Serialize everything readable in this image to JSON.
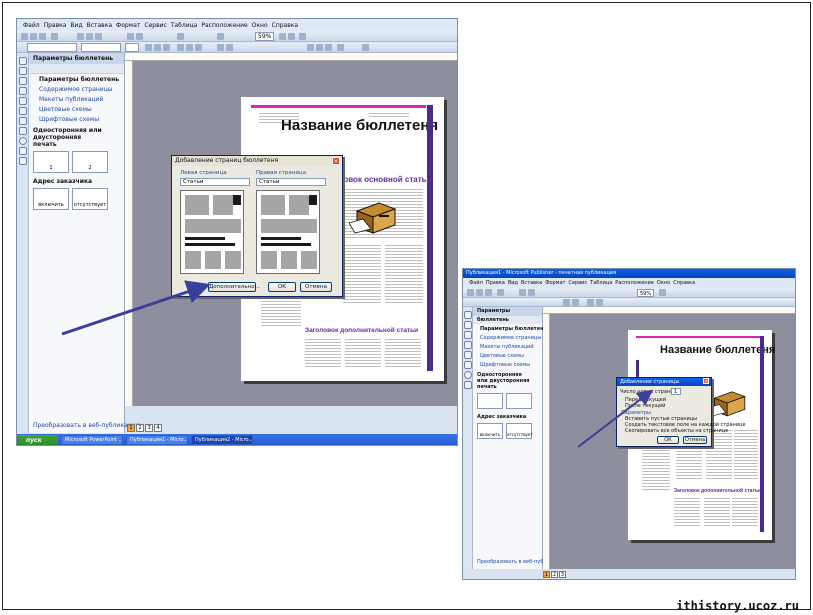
{
  "screenshot_left": {
    "menu": [
      "Файл",
      "Правка",
      "Вид",
      "Вставка",
      "Формат",
      "Сервис",
      "Таблица",
      "Расположение",
      "Окно",
      "Справка"
    ],
    "zoom": "59%",
    "taskpane": {
      "title": "Параметры бюллетень",
      "items": [
        "Параметры бюллетень",
        "Содержимое страницы",
        "Макеты публикаций",
        "Цветовые схемы",
        "Шрифтовые схемы"
      ],
      "print_heading": "Односторонняя или двусторонняя печать",
      "print_options": [
        "1",
        "2"
      ],
      "address_heading": "Адрес заказчика",
      "address_options": [
        "включить",
        "отсутствует"
      ],
      "convert_link": "Преобразовать в веб-публикацию..."
    },
    "newsletter": {
      "title": "Название бюллетеня",
      "main_heading": "Заголовок основной статьи",
      "secondary_heading": "Заголовок дополнительной статьи"
    },
    "dialog": {
      "title": "Добавление страниц бюллетеня",
      "left_label": "Левая страница",
      "right_label": "Правая страница",
      "left_value": "Статьи",
      "right_value": "Статьи",
      "more_button": "Дополнительно...",
      "ok_button": "ОК",
      "cancel_button": "Отмена"
    },
    "page_numbers": [
      "1",
      "2",
      "3",
      "4"
    ],
    "taskbar": {
      "start": "пуск",
      "tasks": [
        "Microsoft PowerPoint ...",
        "Публикация1 - Micro...",
        "Публикация2 - Micro..."
      ]
    }
  },
  "screenshot_right": {
    "window_title": "Публикация1 - Microsoft Publisher - печатная публикация",
    "menu": [
      "Файл",
      "Правка",
      "Вид",
      "Вставка",
      "Формат",
      "Сервис",
      "Таблица",
      "Расположение",
      "Окно",
      "Справка"
    ],
    "zoom": "59%",
    "taskpane": {
      "title": "Параметры бюллетень",
      "items": [
        "Параметры бюллетень",
        "Содержимое страницы",
        "Макеты публикаций",
        "Цветовые схемы",
        "Шрифтовые схемы"
      ],
      "print_heading": "Односторонняя или двусторонняя печать",
      "address_heading": "Адрес заказчика",
      "address_options": [
        "включить",
        "отсутствует"
      ],
      "convert_link": "Преобразовать в веб-публикацию..."
    },
    "newsletter": {
      "title": "Название бюллетеня",
      "secondary_heading": "Заголовок дополнительной статьи"
    },
    "dialog": {
      "title": "Добавление страницы",
      "count_label": "Число новых страниц:",
      "count_value": "1",
      "radio_before": "Перед текущей",
      "radio_after": "После текущей",
      "section_label": "Параметры",
      "option_empty": "Вставить пустые страницы",
      "option_textbox": "Создать текстовое поле на каждой странице",
      "option_copy": "Скопировать все объекты на странице",
      "ok_button": "ОК",
      "cancel_button": "Отмена"
    },
    "page_numbers": [
      "1",
      "2",
      "3"
    ]
  },
  "watermark": "ithistory.ucoz.ru",
  "colors": {
    "arrow": "#3b3f9a",
    "accent_pink": "#e21fb6",
    "accent_purple": "#4b2b8f",
    "workspace": "#8e8f9e"
  }
}
